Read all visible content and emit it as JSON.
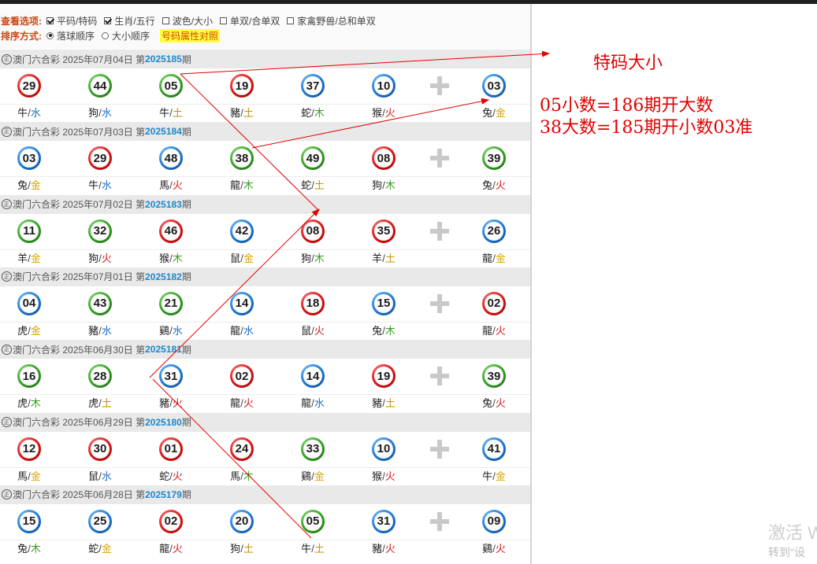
{
  "options": {
    "view_label": "查看选项:",
    "view_opts": [
      {
        "label": "平码/特码",
        "checked": true
      },
      {
        "label": "生肖/五行",
        "checked": true
      },
      {
        "label": "波色/大小",
        "checked": false
      },
      {
        "label": "单双/合单双",
        "checked": false
      },
      {
        "label": "家禽野兽/总和单双",
        "checked": false
      }
    ],
    "sort_label": "排序方式:",
    "sort_opts": [
      {
        "label": "落球顺序",
        "selected": true
      },
      {
        "label": "大小顺序",
        "selected": false
      }
    ],
    "attr_link": "号码属性对照"
  },
  "seal_char": "正",
  "periods": [
    {
      "lottery": "澳门六合彩",
      "date": "2025年07月04日",
      "prefix": "第",
      "number": "2025185",
      "suffix": "期",
      "balls": [
        {
          "n": "29",
          "c": "red",
          "z": "牛",
          "e": "水"
        },
        {
          "n": "44",
          "c": "green",
          "z": "狗",
          "e": "水"
        },
        {
          "n": "05",
          "c": "green",
          "z": "牛",
          "e": "土"
        },
        {
          "n": "19",
          "c": "red",
          "z": "豬",
          "e": "土"
        },
        {
          "n": "37",
          "c": "blue",
          "z": "蛇",
          "e": "木"
        },
        {
          "n": "10",
          "c": "blue",
          "z": "猴",
          "e": "火"
        },
        {
          "n": "03",
          "c": "blue",
          "z": "兔",
          "e": "金"
        }
      ]
    },
    {
      "lottery": "澳门六合彩",
      "date": "2025年07月03日",
      "prefix": "第",
      "number": "2025184",
      "suffix": "期",
      "balls": [
        {
          "n": "03",
          "c": "blue",
          "z": "兔",
          "e": "金"
        },
        {
          "n": "29",
          "c": "red",
          "z": "牛",
          "e": "水"
        },
        {
          "n": "48",
          "c": "blue",
          "z": "馬",
          "e": "火"
        },
        {
          "n": "38",
          "c": "green",
          "z": "龍",
          "e": "木"
        },
        {
          "n": "49",
          "c": "green",
          "z": "蛇",
          "e": "土"
        },
        {
          "n": "08",
          "c": "red",
          "z": "狗",
          "e": "木"
        },
        {
          "n": "39",
          "c": "green",
          "z": "兔",
          "e": "火"
        }
      ]
    },
    {
      "lottery": "澳门六合彩",
      "date": "2025年07月02日",
      "prefix": "第",
      "number": "2025183",
      "suffix": "期",
      "balls": [
        {
          "n": "11",
          "c": "green",
          "z": "羊",
          "e": "金"
        },
        {
          "n": "32",
          "c": "green",
          "z": "狗",
          "e": "火"
        },
        {
          "n": "46",
          "c": "red",
          "z": "猴",
          "e": "木"
        },
        {
          "n": "42",
          "c": "blue",
          "z": "鼠",
          "e": "金"
        },
        {
          "n": "08",
          "c": "red",
          "z": "狗",
          "e": "木"
        },
        {
          "n": "35",
          "c": "red",
          "z": "羊",
          "e": "土"
        },
        {
          "n": "26",
          "c": "blue",
          "z": "龍",
          "e": "金"
        }
      ]
    },
    {
      "lottery": "澳门六合彩",
      "date": "2025年07月01日",
      "prefix": "第",
      "number": "2025182",
      "suffix": "期",
      "balls": [
        {
          "n": "04",
          "c": "blue",
          "z": "虎",
          "e": "金"
        },
        {
          "n": "43",
          "c": "green",
          "z": "豬",
          "e": "水"
        },
        {
          "n": "21",
          "c": "green",
          "z": "鷄",
          "e": "水"
        },
        {
          "n": "14",
          "c": "blue",
          "z": "龍",
          "e": "水"
        },
        {
          "n": "18",
          "c": "red",
          "z": "鼠",
          "e": "火"
        },
        {
          "n": "15",
          "c": "blue",
          "z": "兔",
          "e": "木"
        },
        {
          "n": "02",
          "c": "red",
          "z": "龍",
          "e": "火"
        }
      ]
    },
    {
      "lottery": "澳门六合彩",
      "date": "2025年06月30日",
      "prefix": "第",
      "number": "2025181",
      "suffix": "期",
      "balls": [
        {
          "n": "16",
          "c": "green",
          "z": "虎",
          "e": "木"
        },
        {
          "n": "28",
          "c": "green",
          "z": "虎",
          "e": "土"
        },
        {
          "n": "31",
          "c": "blue",
          "z": "豬",
          "e": "火"
        },
        {
          "n": "02",
          "c": "red",
          "z": "龍",
          "e": "火"
        },
        {
          "n": "14",
          "c": "blue",
          "z": "龍",
          "e": "水"
        },
        {
          "n": "19",
          "c": "red",
          "z": "豬",
          "e": "土"
        },
        {
          "n": "39",
          "c": "green",
          "z": "兔",
          "e": "火"
        }
      ]
    },
    {
      "lottery": "澳门六合彩",
      "date": "2025年06月29日",
      "prefix": "第",
      "number": "2025180",
      "suffix": "期",
      "balls": [
        {
          "n": "12",
          "c": "red",
          "z": "馬",
          "e": "金"
        },
        {
          "n": "30",
          "c": "red",
          "z": "鼠",
          "e": "水"
        },
        {
          "n": "01",
          "c": "red",
          "z": "蛇",
          "e": "火"
        },
        {
          "n": "24",
          "c": "red",
          "z": "馬",
          "e": "木"
        },
        {
          "n": "33",
          "c": "green",
          "z": "鷄",
          "e": "金"
        },
        {
          "n": "10",
          "c": "blue",
          "z": "猴",
          "e": "火"
        },
        {
          "n": "41",
          "c": "blue",
          "z": "牛",
          "e": "金"
        }
      ]
    },
    {
      "lottery": "澳门六合彩",
      "date": "2025年06月28日",
      "prefix": "第",
      "number": "2025179",
      "suffix": "期",
      "balls": [
        {
          "n": "15",
          "c": "blue",
          "z": "兔",
          "e": "木"
        },
        {
          "n": "25",
          "c": "blue",
          "z": "蛇",
          "e": "金"
        },
        {
          "n": "02",
          "c": "red",
          "z": "龍",
          "e": "火"
        },
        {
          "n": "20",
          "c": "blue",
          "z": "狗",
          "e": "土"
        },
        {
          "n": "05",
          "c": "green",
          "z": "牛",
          "e": "土"
        },
        {
          "n": "31",
          "c": "blue",
          "z": "豬",
          "e": "火"
        },
        {
          "n": "09",
          "c": "blue",
          "z": "鷄",
          "e": "火"
        }
      ]
    }
  ],
  "colors": {
    "red": "#d40f0f",
    "blue": "#1872cc",
    "green": "#2e9a1f",
    "annotation": "#e10000",
    "period_number": "#1d87c8"
  },
  "annotations": {
    "title": "特码大小",
    "line1": "05小数=186期开大数",
    "line2": "38大数=185期开小数03准"
  },
  "watermark": {
    "line1": "激活 W",
    "line2": "转到\"设"
  }
}
